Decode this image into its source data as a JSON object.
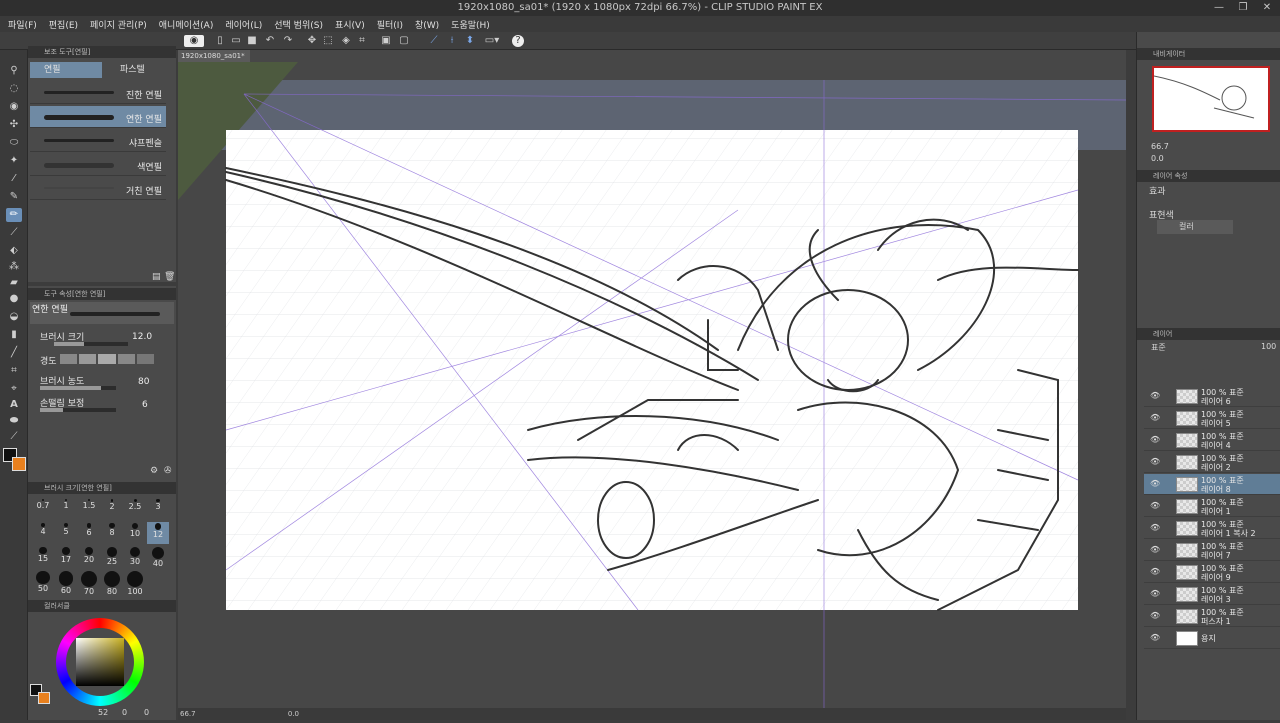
{
  "window": {
    "title": "1920x1080_sa01* (1920 x 1080px 72dpi 66.7%) - CLIP STUDIO PAINT EX",
    "minimize": "—",
    "maximize": "❐",
    "close": "✕"
  },
  "menu": [
    "파일(F)",
    "편집(E)",
    "페이지 관리(P)",
    "애니메이션(A)",
    "레이어(L)",
    "선택 범위(S)",
    "표시(V)",
    "필터(I)",
    "창(W)",
    "도움말(H)"
  ],
  "document_tab": "1920x1080_sa01*",
  "subtool_panel": {
    "header": "보조 도구[연필]",
    "tabs": [
      "연필",
      "파스텔"
    ],
    "brushes": [
      "진한 연필",
      "연한 연필",
      "샤프펜슬",
      "색연필",
      "거친 연필"
    ],
    "selected_index": 1
  },
  "tool_property": {
    "header": "도구 속성[연한 연필]",
    "preset_name": "연한 연필",
    "brush_size_label": "브러시 크기",
    "brush_size_value": "12.0",
    "hardness_label": "경도",
    "density_label": "브러시 농도",
    "density_value": "80",
    "stabilization_label": "손떨림 보정",
    "stabilization_value": "6"
  },
  "brush_size_panel": {
    "header": "브러시 크기[연한 연필]",
    "sizes": [
      "0.7",
      "1",
      "1.5",
      "2",
      "2.5",
      "3",
      "4",
      "5",
      "6",
      "8",
      "10",
      "12",
      "15",
      "17",
      "20",
      "25",
      "30",
      "40",
      "50",
      "60",
      "70",
      "80",
      "100"
    ],
    "selected": "12"
  },
  "color_panel": {
    "header": "컬러서클",
    "hue_value": "52",
    "sat_value": "0",
    "val_value": "0"
  },
  "navigator": {
    "header": "내비게이터",
    "zoom": "66.7",
    "rotation": "0.0"
  },
  "layer_property": {
    "header": "레이어 속성",
    "effect_label": "효과",
    "expression_color_label": "표현색",
    "expression_color_value": "컬러"
  },
  "layer_panel": {
    "header": "레이어",
    "blend_mode": "표준",
    "opacity": "100",
    "layers": [
      {
        "line1": "100 % 표준",
        "line2": "레이어 6"
      },
      {
        "line1": "100 % 표준",
        "line2": "레이어 5"
      },
      {
        "line1": "100 % 표준",
        "line2": "레이어 4"
      },
      {
        "line1": "100 % 표준",
        "line2": "레이어 2"
      },
      {
        "line1": "100 % 표준",
        "line2": "레이어 8"
      },
      {
        "line1": "100 % 표준",
        "line2": "레이어 1"
      },
      {
        "line1": "100 % 표준",
        "line2": "레이어 1 복사 2"
      },
      {
        "line1": "100 % 표준",
        "line2": "레이어 7"
      },
      {
        "line1": "100 % 표준",
        "line2": "레이어 9"
      },
      {
        "line1": "100 % 표준",
        "line2": "레이어 3"
      },
      {
        "line1": "100 % 표준",
        "line2": "퍼스자 1"
      },
      {
        "line1": "",
        "line2": "용지"
      }
    ],
    "selected_index": 4
  },
  "status_bar": {
    "zoom": "66.7",
    "angle": "0.0"
  },
  "colors": {
    "accent": "#6f8aa4",
    "main_color": "#111111",
    "sub_color": "#e8801e",
    "panel": "#4a4a4a"
  }
}
